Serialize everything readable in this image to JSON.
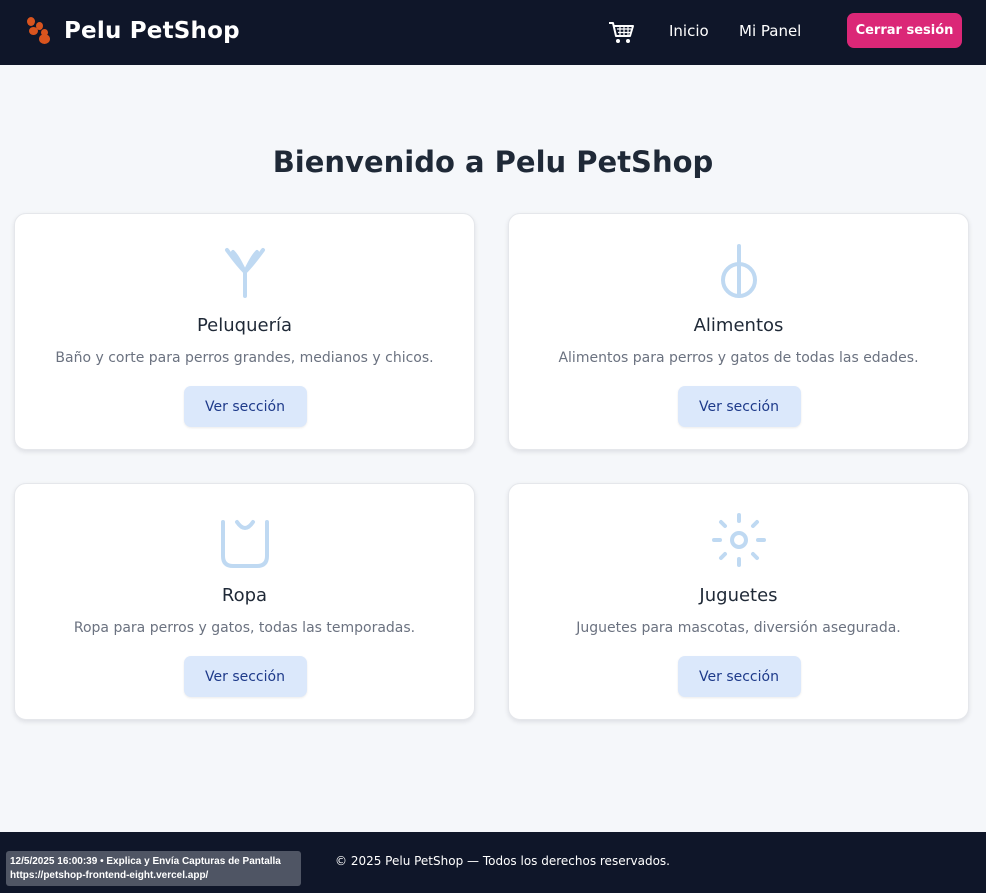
{
  "header": {
    "brand": "Pelu PetShop",
    "icons": {
      "logo": "paw-icon",
      "cart": "cart-icon"
    },
    "nav": {
      "home": "Inicio",
      "panel": "Mi Panel"
    },
    "logout": "Cerrar sesión"
  },
  "main": {
    "title": "Bienvenido a Pelu PetShop",
    "cards": [
      {
        "icon": "scissors-icon",
        "title": "Peluquería",
        "description": "Baño y corte para perros grandes, medianos y chicos.",
        "button": "Ver sección"
      },
      {
        "icon": "bowl-icon",
        "title": "Alimentos",
        "description": "Alimentos para perros y gatos de todas las edades.",
        "button": "Ver sección"
      },
      {
        "icon": "shirt-icon",
        "title": "Ropa",
        "description": "Ropa para perros y gatos, todas las temporadas.",
        "button": "Ver sección"
      },
      {
        "icon": "toy-icon",
        "title": "Juguetes",
        "description": "Juguetes para mascotas, diversión asegurada.",
        "button": "Ver sección"
      }
    ]
  },
  "footer": {
    "copyright": "© 2025 Pelu PetShop — Todos los derechos reservados."
  },
  "overlay": {
    "line1": "12/5/2025 16:00:39 • Explica y Envía Capturas de Pantalla",
    "line2": "https://petshop-frontend-eight.vercel.app/"
  },
  "colors": {
    "navbar": "#0f1629",
    "accent": "#db2777",
    "button_bg": "#dbe8fb",
    "button_text": "#1e3a8a",
    "icon": "#bfd9f2"
  }
}
